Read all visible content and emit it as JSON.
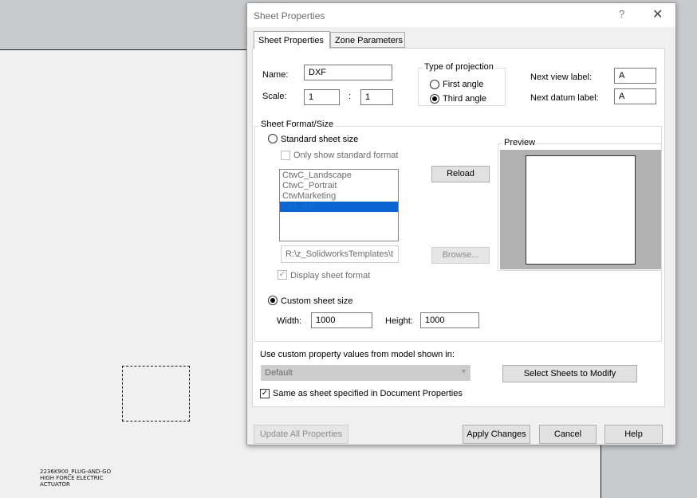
{
  "drawing": {
    "note_lines": [
      "2236K900_PLUG-AND-GO",
      "HIGH FORCE ELECTRIC",
      "ACTUATOR"
    ]
  },
  "dialog": {
    "title": "Sheet Properties",
    "help_glyph": "?",
    "close_glyph": "✕",
    "tabs": [
      {
        "label": "Sheet Properties",
        "active": true
      },
      {
        "label": "Zone Parameters",
        "active": false
      }
    ],
    "name_label": "Name:",
    "name_value": "DXF",
    "scale_label": "Scale:",
    "scale_num": "1",
    "scale_sep": ":",
    "scale_den": "1",
    "projection": {
      "title": "Type of projection",
      "options": [
        {
          "label": "First angle",
          "selected": false
        },
        {
          "label": "Third angle",
          "selected": true
        }
      ]
    },
    "next_view_label": "Next view label:",
    "next_view_value": "A",
    "next_datum_label": "Next datum label:",
    "next_datum_value": "A",
    "sheet_format": {
      "title": "Sheet Format/Size",
      "standard_label": "Standard sheet size",
      "standard_selected": false,
      "only_standard_label": "Only show standard format",
      "formats": [
        "CtwC_Landscape",
        "CtwC_Portrait",
        "CtwMarketing",
        "Ctw_dxf"
      ],
      "selected_format": "Ctw_dxf",
      "reload_label": "Reload",
      "path_value": "R:\\z_SolidworksTemplates\\t",
      "browse_label": "Browse...",
      "display_format_label": "Display sheet format",
      "display_format_checked": true,
      "preview_title": "Preview",
      "custom_label": "Custom sheet size",
      "custom_selected": true,
      "width_label": "Width:",
      "width_value": "1000",
      "height_label": "Height:",
      "height_value": "1000"
    },
    "custom_property_label": "Use custom property values from model shown in:",
    "custom_property_value": "Default",
    "select_sheets_label": "Select Sheets to Modify",
    "same_as_label": "Same as sheet specified in Document Properties",
    "same_as_checked": true,
    "footer": {
      "update_all": "Update All Properties",
      "apply": "Apply Changes",
      "cancel": "Cancel",
      "help": "Help"
    },
    "check_glyph": "✓"
  }
}
